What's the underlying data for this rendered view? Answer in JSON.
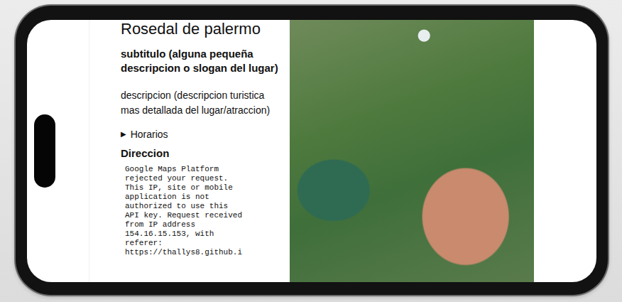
{
  "page": {
    "title": "Rosedal de palermo",
    "subtitle": "subtitulo (alguna pequeña descripcion o slogan del lugar)",
    "description": "descripcion (descripcion turistica mas detallada del lugar/atraccion)",
    "details": {
      "icon": "▶",
      "label": "Horarios",
      "expanded": false
    },
    "address_heading": "Direccion",
    "map_error_lines": [
      "Google Maps Platform",
      "rejected your request.",
      "This IP, site or mobile",
      "application is not",
      "authorized to use this",
      "API key. Request received",
      "from IP address",
      "154.16.15.153, with",
      "referer:",
      "https://thallys8.github.i"
    ]
  }
}
